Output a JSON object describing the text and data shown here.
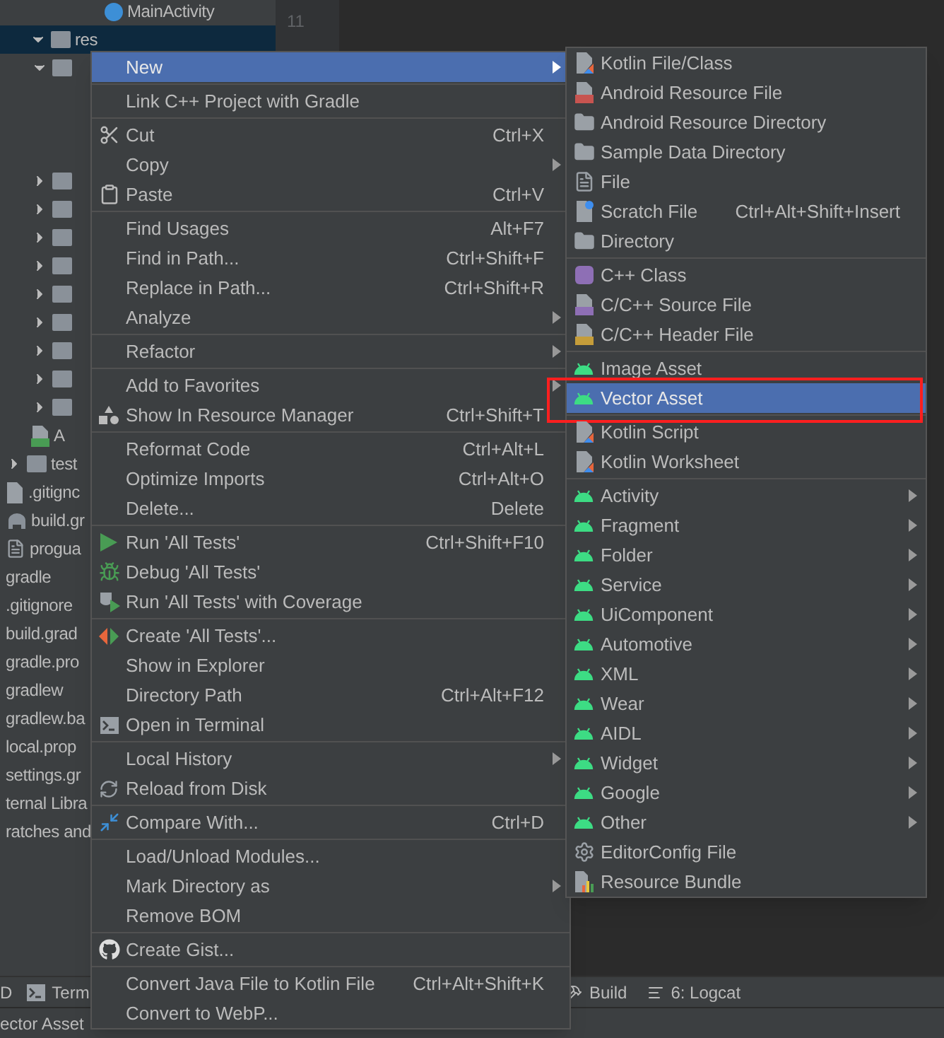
{
  "tree": [
    {
      "kind": "class",
      "label": "MainActivity"
    },
    {
      "kind": "folder",
      "label": "res",
      "expanded": true,
      "selected": true,
      "children": [
        {
          "kind": "folder",
          "expanded": true,
          "selected": false
        },
        {
          "kind": "folder",
          "expanded": false,
          "selected": false
        },
        {
          "kind": "folder",
          "expanded": false,
          "selected": false
        },
        {
          "kind": "folder",
          "expanded": false,
          "selected": false
        },
        {
          "kind": "folder",
          "expanded": false,
          "selected": false
        },
        {
          "kind": "folder",
          "expanded": false,
          "selected": false
        },
        {
          "kind": "folder",
          "expanded": false,
          "selected": false
        },
        {
          "kind": "folder",
          "expanded": false,
          "selected": false
        },
        {
          "kind": "folder",
          "expanded": false,
          "selected": false
        },
        {
          "kind": "folder",
          "expanded": false,
          "selected": false
        },
        {
          "kind": "manifest",
          "label": "A"
        }
      ]
    },
    {
      "kind": "folder",
      "label": "test",
      "expanded": false,
      "selected": false
    },
    {
      "kind": "ignore",
      "label": ".gitignc"
    },
    {
      "kind": "gradle",
      "label": "build.gr"
    },
    {
      "kind": "text",
      "label": "progua"
    },
    {
      "kind": "plain",
      "label": "gradle"
    },
    {
      "kind": "plain",
      "label": ".gitignore"
    },
    {
      "kind": "plain",
      "label": "build.grad"
    },
    {
      "kind": "plain",
      "label": "gradle.pro"
    },
    {
      "kind": "plain",
      "label": "gradlew"
    },
    {
      "kind": "plain",
      "label": "gradlew.ba"
    },
    {
      "kind": "plain",
      "label": "local.prop"
    },
    {
      "kind": "plain",
      "label": "settings.gr"
    },
    {
      "kind": "plain",
      "label": "ternal Libra"
    },
    {
      "kind": "plain",
      "label": "ratches and"
    }
  ],
  "editor": {
    "line_number": "11"
  },
  "context_menu": [
    [
      {
        "kind": "plain",
        "label": "New",
        "has_submenu": true,
        "selected": true
      }
    ],
    [
      {
        "kind": "plain",
        "label": "Link C++ Project with Gradle",
        "has_submenu": false,
        "selected": false
      }
    ],
    [
      {
        "kind": "scissors",
        "label": "Cut",
        "shortcut": "Ctrl+X",
        "has_submenu": false,
        "selected": false
      },
      {
        "kind": "plain",
        "label": "Copy",
        "has_submenu": true,
        "selected": false
      },
      {
        "kind": "clipboard",
        "label": "Paste",
        "shortcut": "Ctrl+V",
        "has_submenu": false,
        "selected": false
      }
    ],
    [
      {
        "kind": "plain",
        "label": "Find Usages",
        "shortcut": "Alt+F7",
        "has_submenu": false,
        "selected": false
      },
      {
        "kind": "plain",
        "label": "Find in Path...",
        "shortcut": "Ctrl+Shift+F",
        "has_submenu": false,
        "selected": false
      },
      {
        "kind": "plain",
        "label": "Replace in Path...",
        "shortcut": "Ctrl+Shift+R",
        "has_submenu": false,
        "selected": false
      },
      {
        "kind": "plain",
        "label": "Analyze",
        "has_submenu": true,
        "selected": false
      }
    ],
    [
      {
        "kind": "plain",
        "label": "Refactor",
        "has_submenu": true,
        "selected": false
      }
    ],
    [
      {
        "kind": "plain",
        "label": "Add to Favorites",
        "has_submenu": true,
        "selected": false
      },
      {
        "kind": "shapes",
        "label": "Show In Resource Manager",
        "shortcut": "Ctrl+Shift+T",
        "has_submenu": false,
        "selected": false
      }
    ],
    [
      {
        "kind": "plain",
        "label": "Reformat Code",
        "shortcut": "Ctrl+Alt+L",
        "has_submenu": false,
        "selected": false
      },
      {
        "kind": "plain",
        "label": "Optimize Imports",
        "shortcut": "Ctrl+Alt+O",
        "has_submenu": false,
        "selected": false
      },
      {
        "kind": "plain",
        "label": "Delete...",
        "shortcut": "Delete",
        "has_submenu": false,
        "selected": false
      }
    ],
    [
      {
        "kind": "run",
        "label": "Run 'All Tests'",
        "shortcut": "Ctrl+Shift+F10",
        "has_submenu": false,
        "selected": false
      },
      {
        "kind": "bug",
        "label": "Debug 'All Tests'",
        "has_submenu": false,
        "selected": false
      },
      {
        "kind": "coverage",
        "label": "Run 'All Tests' with Coverage",
        "has_submenu": false,
        "selected": false
      }
    ],
    [
      {
        "kind": "create",
        "label": "Create 'All Tests'...",
        "has_submenu": false,
        "selected": false
      },
      {
        "kind": "plain",
        "label": "Show in Explorer",
        "has_submenu": false,
        "selected": false
      },
      {
        "kind": "plain",
        "label": "Directory Path",
        "shortcut": "Ctrl+Alt+F12",
        "has_submenu": false,
        "selected": false
      },
      {
        "kind": "terminal",
        "label": "Open in Terminal",
        "has_submenu": false,
        "selected": false
      }
    ],
    [
      {
        "kind": "plain",
        "label": "Local History",
        "has_submenu": true,
        "selected": false
      },
      {
        "kind": "reload",
        "label": "Reload from Disk",
        "has_submenu": false,
        "selected": false
      }
    ],
    [
      {
        "kind": "compare",
        "label": "Compare With...",
        "shortcut": "Ctrl+D",
        "has_submenu": false,
        "selected": false
      }
    ],
    [
      {
        "kind": "plain",
        "label": "Load/Unload Modules...",
        "has_submenu": false,
        "selected": false
      },
      {
        "kind": "plain",
        "label": "Mark Directory as",
        "has_submenu": true,
        "selected": false
      },
      {
        "kind": "plain",
        "label": "Remove BOM",
        "has_submenu": false,
        "selected": false
      }
    ],
    [
      {
        "kind": "github",
        "label": "Create Gist...",
        "has_submenu": false,
        "selected": false
      }
    ],
    [
      {
        "kind": "plain",
        "label": "Convert Java File to Kotlin File",
        "shortcut": "Ctrl+Alt+Shift+K",
        "has_submenu": false,
        "selected": false
      },
      {
        "kind": "plain",
        "label": "Convert to WebP...",
        "has_submenu": false,
        "selected": false
      }
    ]
  ],
  "new_submenu": [
    [
      {
        "kind": "kotlin",
        "label": "Kotlin File/Class",
        "has_submenu": false,
        "selected": false,
        "highlighted": false
      },
      {
        "kind": "resource-file",
        "label": "Android Resource File",
        "has_submenu": false,
        "selected": false,
        "highlighted": false
      },
      {
        "kind": "folder",
        "label": "Android Resource Directory",
        "has_submenu": false,
        "selected": false,
        "highlighted": false
      },
      {
        "kind": "folder",
        "label": "Sample Data Directory",
        "has_submenu": false,
        "selected": false,
        "highlighted": false
      },
      {
        "kind": "file",
        "label": "File",
        "has_submenu": false,
        "selected": false,
        "highlighted": false
      },
      {
        "kind": "scratch",
        "label": "Scratch File",
        "shortcut": "Ctrl+Alt+Shift+Insert",
        "has_submenu": false,
        "selected": false,
        "highlighted": false
      },
      {
        "kind": "folder",
        "label": "Directory",
        "has_submenu": false,
        "selected": false,
        "highlighted": false
      }
    ],
    [
      {
        "kind": "cpp-class",
        "label": "C++ Class",
        "has_submenu": false,
        "selected": false,
        "highlighted": false
      },
      {
        "kind": "cpp-source",
        "label": "C/C++ Source File",
        "has_submenu": false,
        "selected": false,
        "highlighted": false
      },
      {
        "kind": "cpp-header",
        "label": "C/C++ Header File",
        "has_submenu": false,
        "selected": false,
        "highlighted": false
      }
    ],
    [
      {
        "kind": "android",
        "label": "Image Asset",
        "has_submenu": false,
        "selected": false,
        "highlighted": false
      },
      {
        "kind": "android",
        "label": "Vector Asset",
        "has_submenu": false,
        "selected": true,
        "highlighted": true
      }
    ],
    [
      {
        "kind": "kotlin",
        "label": "Kotlin Script",
        "has_submenu": false,
        "selected": false,
        "highlighted": false
      },
      {
        "kind": "kotlin",
        "label": "Kotlin Worksheet",
        "has_submenu": false,
        "selected": false,
        "highlighted": false
      }
    ],
    [
      {
        "kind": "android",
        "label": "Activity",
        "has_submenu": true,
        "selected": false,
        "highlighted": false
      },
      {
        "kind": "android",
        "label": "Fragment",
        "has_submenu": true,
        "selected": false,
        "highlighted": false
      },
      {
        "kind": "android",
        "label": "Folder",
        "has_submenu": true,
        "selected": false,
        "highlighted": false
      },
      {
        "kind": "android",
        "label": "Service",
        "has_submenu": true,
        "selected": false,
        "highlighted": false
      },
      {
        "kind": "android",
        "label": "UiComponent",
        "has_submenu": true,
        "selected": false,
        "highlighted": false
      },
      {
        "kind": "android",
        "label": "Automotive",
        "has_submenu": true,
        "selected": false,
        "highlighted": false
      },
      {
        "kind": "android",
        "label": "XML",
        "has_submenu": true,
        "selected": false,
        "highlighted": false
      },
      {
        "kind": "android",
        "label": "Wear",
        "has_submenu": true,
        "selected": false,
        "highlighted": false
      },
      {
        "kind": "android",
        "label": "AIDL",
        "has_submenu": true,
        "selected": false,
        "highlighted": false
      },
      {
        "kind": "android",
        "label": "Widget",
        "has_submenu": true,
        "selected": false,
        "highlighted": false
      },
      {
        "kind": "android",
        "label": "Google",
        "has_submenu": true,
        "selected": false,
        "highlighted": false
      },
      {
        "kind": "android",
        "label": "Other",
        "has_submenu": true,
        "selected": false,
        "highlighted": false
      },
      {
        "kind": "gear",
        "label": "EditorConfig File",
        "has_submenu": false,
        "selected": false,
        "highlighted": false
      },
      {
        "kind": "bundle",
        "label": "Resource Bundle",
        "has_submenu": false,
        "selected": false,
        "highlighted": false
      }
    ]
  ],
  "tool_bar_left": [
    {
      "kind": "plain",
      "label": "D"
    },
    {
      "kind": "terminal",
      "label": "Term"
    }
  ],
  "tool_bar_right": [
    {
      "kind": "build",
      "label": "Build"
    },
    {
      "kind": "logcat",
      "label": "6: Logcat"
    }
  ],
  "status_bar": {
    "message": "ector Asset"
  }
}
